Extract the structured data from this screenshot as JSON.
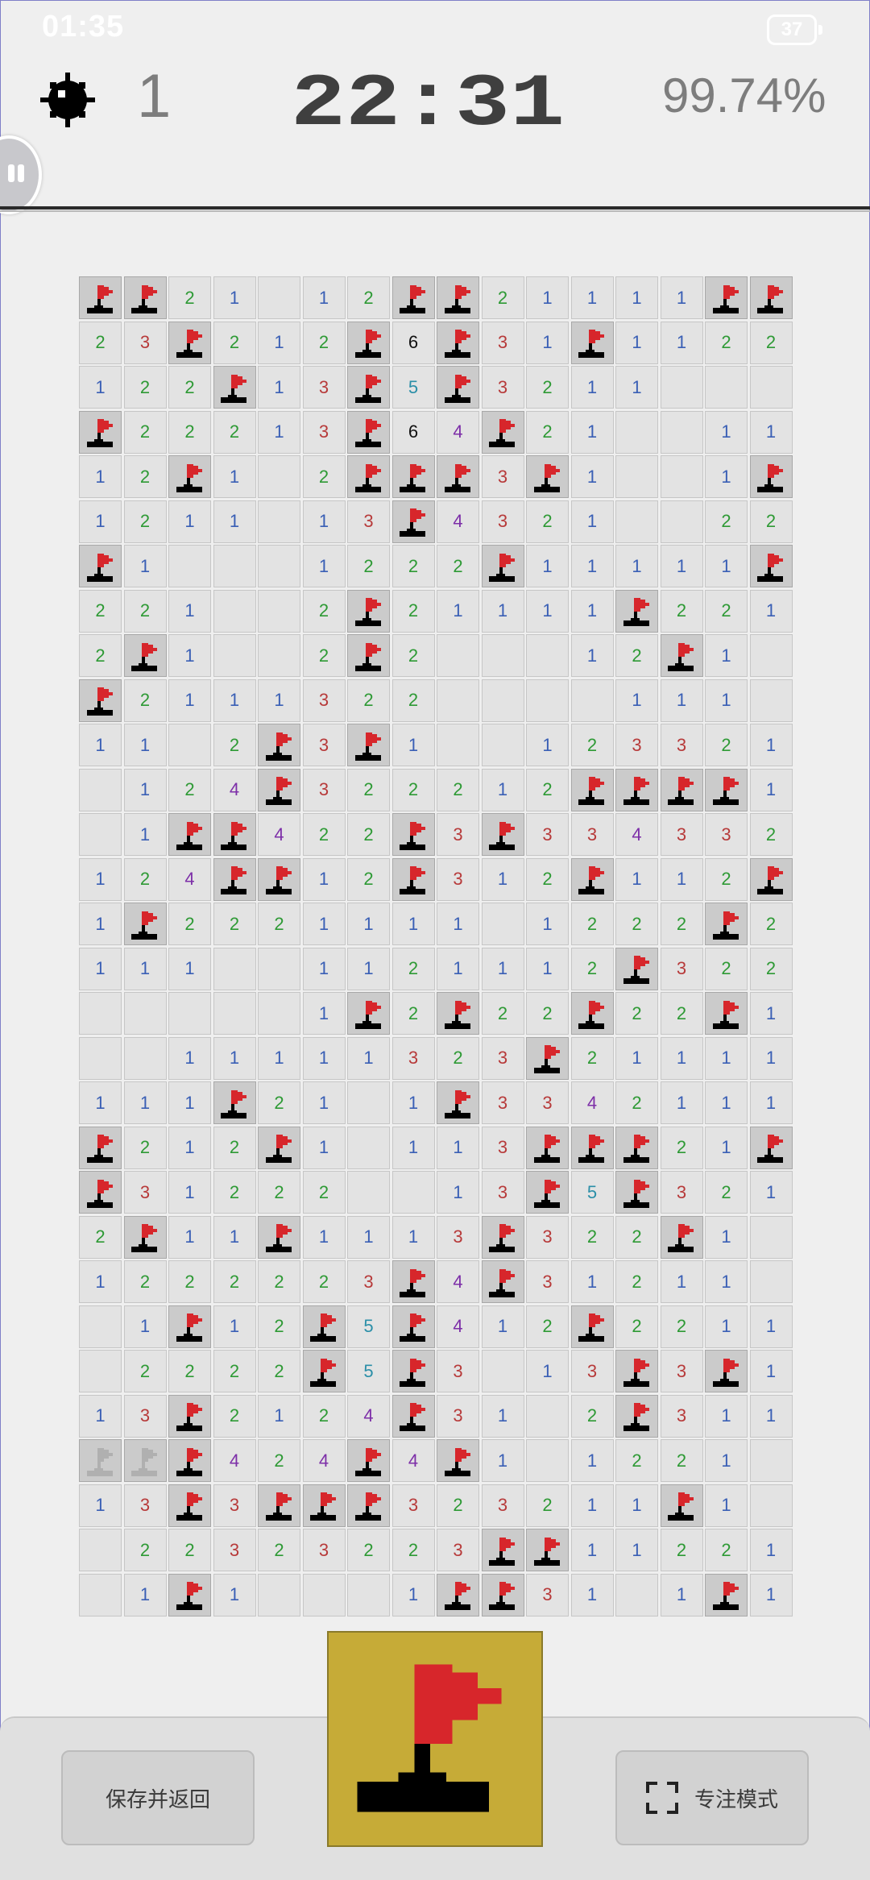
{
  "status_bar": {
    "time": "01:35",
    "battery": "37"
  },
  "header": {
    "mine_icon": "mine-icon",
    "mines_remaining": "1",
    "timer": "22:31",
    "progress": "99.74%"
  },
  "colors": {
    "flag_red": "#d7262b",
    "mode_button_bg": "#c6ab37",
    "n1": "#3a5fb5",
    "n2": "#2e9a35",
    "n3": "#b73a3a",
    "n4": "#7d2fa8",
    "n5": "#2b8fa8",
    "n6": "#111111"
  },
  "board": {
    "columns": 16,
    "legend": {
      "F": "flag",
      "G": "pending flag (gray)",
      "0": "revealed empty",
      "1-8": "number"
    },
    "rows": [
      [
        "F",
        "F",
        "2",
        "1",
        "0",
        "1",
        "2",
        "F",
        "F",
        "2",
        "1",
        "1",
        "1",
        "1",
        "F",
        "F"
      ],
      [
        "2",
        "3",
        "F",
        "2",
        "1",
        "2",
        "F",
        "6",
        "F",
        "3",
        "1",
        "F",
        "1",
        "1",
        "2",
        "2"
      ],
      [
        "1",
        "2",
        "2",
        "F",
        "1",
        "3",
        "F",
        "5",
        "F",
        "3",
        "2",
        "1",
        "1",
        "0",
        "0",
        "0"
      ],
      [
        "F",
        "2",
        "2",
        "2",
        "1",
        "3",
        "F",
        "6",
        "4",
        "F",
        "2",
        "1",
        "0",
        "0",
        "1",
        "1"
      ],
      [
        "1",
        "2",
        "F",
        "1",
        "0",
        "2",
        "F",
        "F",
        "F",
        "3",
        "F",
        "1",
        "0",
        "0",
        "1",
        "F"
      ],
      [
        "1",
        "2",
        "1",
        "1",
        "0",
        "1",
        "3",
        "F",
        "4",
        "3",
        "2",
        "1",
        "0",
        "0",
        "2",
        "2"
      ],
      [
        "F",
        "1",
        "0",
        "0",
        "0",
        "1",
        "2",
        "2",
        "2",
        "F",
        "1",
        "1",
        "1",
        "1",
        "1",
        "F"
      ],
      [
        "2",
        "2",
        "1",
        "0",
        "0",
        "2",
        "F",
        "2",
        "1",
        "1",
        "1",
        "1",
        "F",
        "2",
        "2",
        "1"
      ],
      [
        "2",
        "F",
        "1",
        "0",
        "0",
        "2",
        "F",
        "2",
        "0",
        "0",
        "0",
        "1",
        "2",
        "F",
        "1",
        "0"
      ],
      [
        "F",
        "2",
        "1",
        "1",
        "1",
        "3",
        "2",
        "2",
        "0",
        "0",
        "0",
        "0",
        "1",
        "1",
        "1",
        "0"
      ],
      [
        "1",
        "1",
        "0",
        "2",
        "F",
        "3",
        "F",
        "1",
        "0",
        "0",
        "1",
        "2",
        "3",
        "3",
        "2",
        "1"
      ],
      [
        "0",
        "1",
        "2",
        "4",
        "F",
        "3",
        "2",
        "2",
        "2",
        "1",
        "2",
        "F",
        "F",
        "F",
        "F",
        "1"
      ],
      [
        "0",
        "1",
        "F",
        "F",
        "4",
        "2",
        "2",
        "F",
        "3",
        "F",
        "3",
        "3",
        "4",
        "3",
        "3",
        "2"
      ],
      [
        "1",
        "2",
        "4",
        "F",
        "F",
        "1",
        "2",
        "F",
        "3",
        "1",
        "2",
        "F",
        "1",
        "1",
        "2",
        "F"
      ],
      [
        "1",
        "F",
        "2",
        "2",
        "2",
        "1",
        "1",
        "1",
        "1",
        "0",
        "1",
        "2",
        "2",
        "2",
        "F",
        "2"
      ],
      [
        "1",
        "1",
        "1",
        "0",
        "0",
        "1",
        "1",
        "2",
        "1",
        "1",
        "1",
        "2",
        "F",
        "3",
        "2",
        "2"
      ],
      [
        "0",
        "0",
        "0",
        "0",
        "0",
        "1",
        "F",
        "2",
        "F",
        "2",
        "2",
        "F",
        "2",
        "2",
        "F",
        "1"
      ],
      [
        "0",
        "0",
        "1",
        "1",
        "1",
        "1",
        "1",
        "3",
        "2",
        "3",
        "F",
        "2",
        "1",
        "1",
        "1",
        "1"
      ],
      [
        "1",
        "1",
        "1",
        "F",
        "2",
        "1",
        "0",
        "1",
        "F",
        "3",
        "3",
        "4",
        "2",
        "1",
        "1",
        "1"
      ],
      [
        "F",
        "2",
        "1",
        "2",
        "F",
        "1",
        "0",
        "1",
        "1",
        "3",
        "F",
        "F",
        "F",
        "2",
        "1",
        "F"
      ],
      [
        "F",
        "3",
        "1",
        "2",
        "2",
        "2",
        "0",
        "0",
        "1",
        "3",
        "F",
        "5",
        "F",
        "3",
        "2",
        "1"
      ],
      [
        "2",
        "F",
        "1",
        "1",
        "F",
        "1",
        "1",
        "1",
        "3",
        "F",
        "3",
        "2",
        "2",
        "F",
        "1",
        "0"
      ],
      [
        "1",
        "2",
        "2",
        "2",
        "2",
        "2",
        "3",
        "F",
        "4",
        "F",
        "3",
        "1",
        "2",
        "1",
        "1",
        "0"
      ],
      [
        "0",
        "1",
        "F",
        "1",
        "2",
        "F",
        "5",
        "F",
        "4",
        "1",
        "2",
        "F",
        "2",
        "2",
        "1",
        "1"
      ],
      [
        "0",
        "2",
        "2",
        "2",
        "2",
        "F",
        "5",
        "F",
        "3",
        "0",
        "1",
        "3",
        "F",
        "3",
        "F",
        "1"
      ],
      [
        "1",
        "3",
        "F",
        "2",
        "1",
        "2",
        "4",
        "F",
        "3",
        "1",
        "0",
        "2",
        "F",
        "3",
        "1",
        "1"
      ],
      [
        "G",
        "G",
        "F",
        "4",
        "2",
        "4",
        "F",
        "4",
        "F",
        "1",
        "0",
        "1",
        "2",
        "2",
        "1",
        "0"
      ],
      [
        "1",
        "3",
        "F",
        "3",
        "F",
        "F",
        "F",
        "3",
        "2",
        "3",
        "2",
        "1",
        "1",
        "F",
        "1",
        "0"
      ],
      [
        "0",
        "2",
        "2",
        "3",
        "2",
        "3",
        "2",
        "2",
        "3",
        "F",
        "F",
        "1",
        "1",
        "2",
        "2",
        "1"
      ],
      [
        "0",
        "1",
        "F",
        "1",
        "0",
        "0",
        "0",
        "1",
        "F",
        "F",
        "3",
        "1",
        "0",
        "1",
        "F",
        "1"
      ]
    ]
  },
  "bottom": {
    "save_label": "保存并返回",
    "focus_label": "专注模式",
    "mode_icon": "flag-icon"
  }
}
